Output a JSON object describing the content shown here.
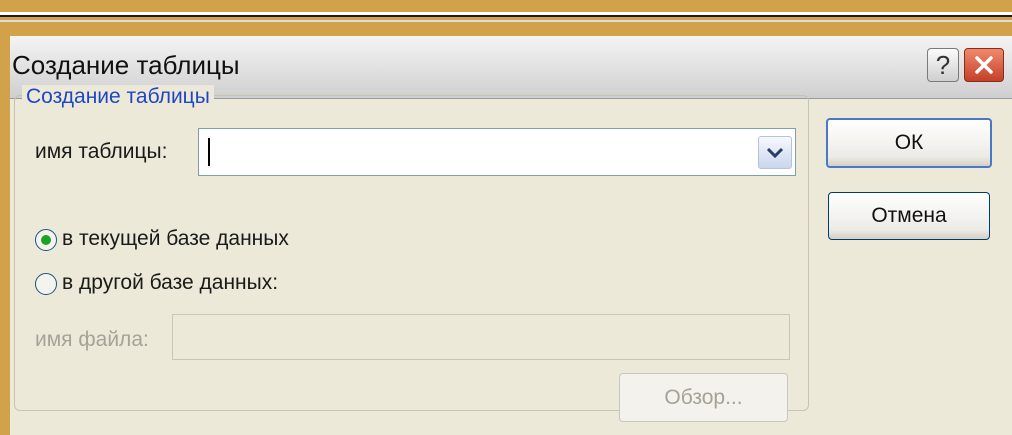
{
  "window": {
    "title": "Создание таблицы",
    "help_label": "?",
    "close_icon": "close-icon"
  },
  "group": {
    "legend": "Создание таблицы"
  },
  "table_name": {
    "label": "имя таблицы:",
    "value": ""
  },
  "radio_current": {
    "label": "в текущей базе данных",
    "checked": true
  },
  "radio_other": {
    "label": "в другой базе данных:",
    "checked": false
  },
  "file_name": {
    "label": "имя файла:",
    "value": ""
  },
  "buttons": {
    "ok": "ОК",
    "cancel": "Отмена",
    "browse": "Обзор..."
  },
  "colors": {
    "accent": "#1f47c4",
    "close_button": "#c4402a",
    "radio_dot": "#21a121",
    "background": "#d2a24a"
  }
}
